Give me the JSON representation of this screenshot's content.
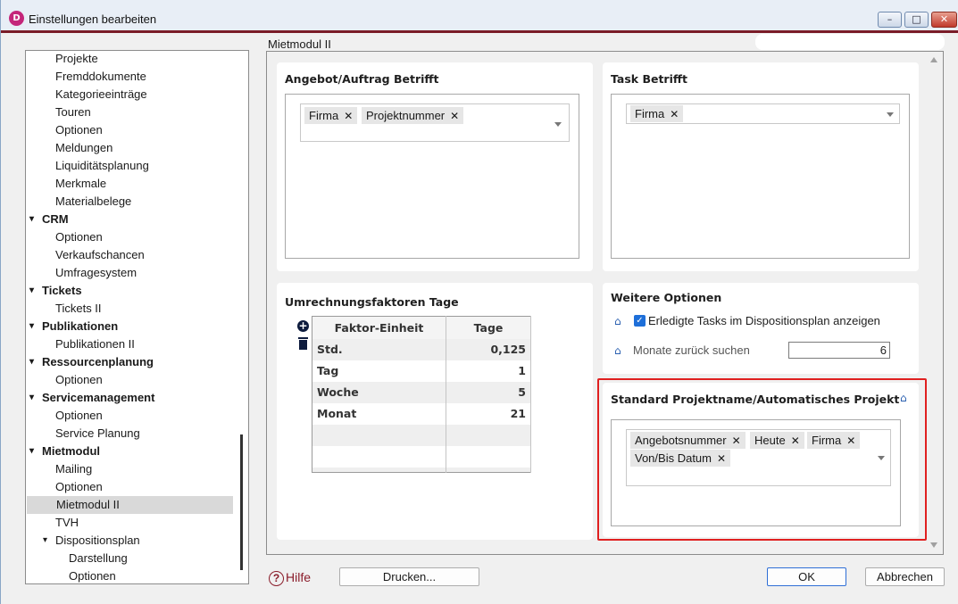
{
  "window": {
    "title": "Einstellungen bearbeiten",
    "app_icon": "app-logo-icon",
    "accent": "#7a1c28"
  },
  "nav": {
    "items": [
      {
        "label": "Projekte",
        "level": 2
      },
      {
        "label": "Fremddokumente",
        "level": 2
      },
      {
        "label": "Kategorieeinträge",
        "level": 2
      },
      {
        "label": "Touren",
        "level": 2
      },
      {
        "label": "Optionen",
        "level": 2
      },
      {
        "label": "Meldungen",
        "level": 2
      },
      {
        "label": "Liquiditätsplanung",
        "level": 2
      },
      {
        "label": "Merkmale",
        "level": 2
      },
      {
        "label": "Materialbelege",
        "level": 2
      },
      {
        "label": "CRM",
        "level": 1
      },
      {
        "label": "Optionen",
        "level": 2
      },
      {
        "label": "Verkaufschancen",
        "level": 2
      },
      {
        "label": "Umfragesystem",
        "level": 2
      },
      {
        "label": "Tickets",
        "level": 1
      },
      {
        "label": "Tickets II",
        "level": 2
      },
      {
        "label": "Publikationen",
        "level": 1
      },
      {
        "label": "Publikationen II",
        "level": 2
      },
      {
        "label": "Ressourcenplanung",
        "level": 1
      },
      {
        "label": "Optionen",
        "level": 2
      },
      {
        "label": "Servicemanagement",
        "level": 1
      },
      {
        "label": "Optionen",
        "level": 2
      },
      {
        "label": "Service Planung",
        "level": 2
      },
      {
        "label": "Mietmodul",
        "level": 1
      },
      {
        "label": "Mailing",
        "level": 2
      },
      {
        "label": "Optionen",
        "level": 2
      },
      {
        "label": "Mietmodul II",
        "level": 2,
        "selected": true
      },
      {
        "label": "TVH",
        "level": 2
      },
      {
        "label": "Dispositionsplan",
        "level": 2,
        "expandable": true
      },
      {
        "label": "Darstellung",
        "level": 3
      },
      {
        "label": "Optionen",
        "level": 3
      }
    ]
  },
  "main": {
    "section_title": "Mietmodul II",
    "angebot": {
      "title": "Angebot/Auftrag Betrifft",
      "chips": [
        "Firma",
        "Projektnummer"
      ]
    },
    "task": {
      "title": "Task Betrifft",
      "chips": [
        "Firma"
      ]
    },
    "umrechnung": {
      "title": "Umrechnungsfaktoren Tage",
      "columns": [
        "Faktor-Einheit",
        "Tage"
      ],
      "rows": [
        {
          "unit": "Std.",
          "value": "0,125"
        },
        {
          "unit": "Tag",
          "value": "1"
        },
        {
          "unit": "Woche",
          "value": "5"
        },
        {
          "unit": "Monat",
          "value": "21"
        }
      ]
    },
    "weitere": {
      "title": "Weitere Optionen",
      "checkbox_label": "Erledigte Tasks im Dispositionsplan anzeigen",
      "checkbox_checked": true,
      "months_label": "Monate zurück suchen",
      "months_value": "6"
    },
    "standard": {
      "title": "Standard Projektname/Automatisches Projekt",
      "chips_row1": [
        "Angebotsnummer",
        "Heute",
        "Firma"
      ],
      "chips_row2": [
        "Von/Bis Datum"
      ],
      "highlight_color": "#e02020"
    }
  },
  "footer": {
    "help_label": "Hilfe",
    "print_label": "Drucken...",
    "ok_label": "OK",
    "cancel_label": "Abbrechen"
  }
}
